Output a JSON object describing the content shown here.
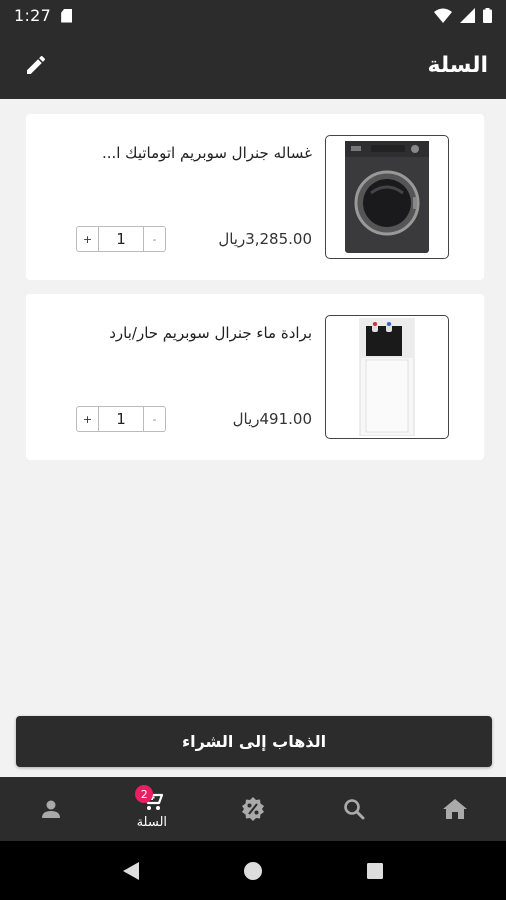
{
  "status_bar": {
    "time": "1:27"
  },
  "app_bar": {
    "title": "السلة"
  },
  "cart": {
    "items": [
      {
        "name": "غساله جنرال سوبريم اتوماتيك ا...",
        "price": "3,285.00ريال",
        "quantity": "1",
        "plus": "+",
        "minus": "-",
        "image": "washing-machine"
      },
      {
        "name": "برادة ماء جنرال سوبريم حار/بارد",
        "price": "491.00ريال",
        "quantity": "1",
        "plus": "+",
        "minus": "-",
        "image": "water-dispenser"
      }
    ]
  },
  "checkout": {
    "label": "الذهاب إلى الشراء"
  },
  "bottom_nav": {
    "items": [
      {
        "icon": "person-icon",
        "label": ""
      },
      {
        "icon": "cart-icon",
        "label": "السلة",
        "badge": "2"
      },
      {
        "icon": "discount-icon",
        "label": ""
      },
      {
        "icon": "search-icon",
        "label": ""
      },
      {
        "icon": "home-icon",
        "label": ""
      }
    ]
  },
  "colors": {
    "dark": "#2c2c2c",
    "background": "#f2f2f2",
    "badge": "#e91e63"
  }
}
